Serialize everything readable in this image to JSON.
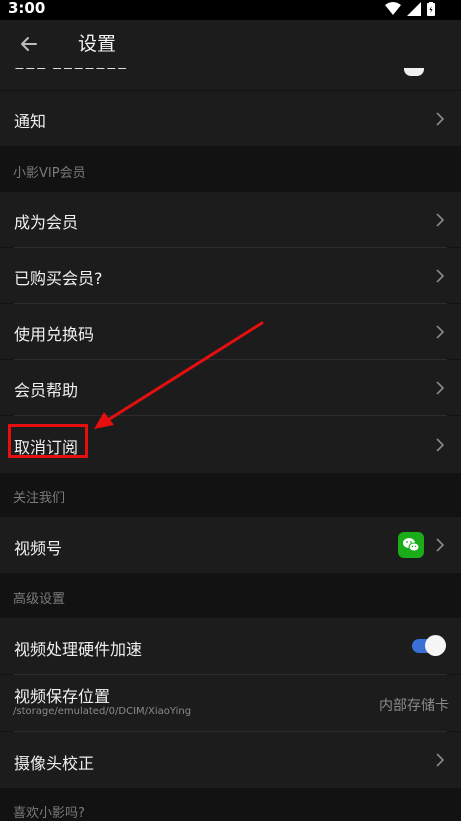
{
  "status_bar": {
    "time": "3:00"
  },
  "app_bar": {
    "title": "设置"
  },
  "rows": {
    "notification": "通知",
    "become_member": "成为会员",
    "purchased": "已购买会员?",
    "redeem": "使用兑换码",
    "help": "会员帮助",
    "cancel": "取消订阅",
    "video_account": "视频号",
    "hw_accel": "视频处理硬件加速",
    "save_location": "视频保存位置",
    "save_path": "/storage/emulated/0/DCIM/XiaoYing",
    "save_value": "内部存储卡",
    "camera": "摄像头校正"
  },
  "sections": {
    "vip": "小影VIP会员",
    "follow": "关注我们",
    "advanced": "高级设置",
    "like": "喜欢小影吗?"
  },
  "toggles": {
    "hw_accel_on": true
  },
  "colors": {
    "accent": "#3a6fd8",
    "wechat": "#1aad19",
    "annotation": "#e60f0f"
  }
}
